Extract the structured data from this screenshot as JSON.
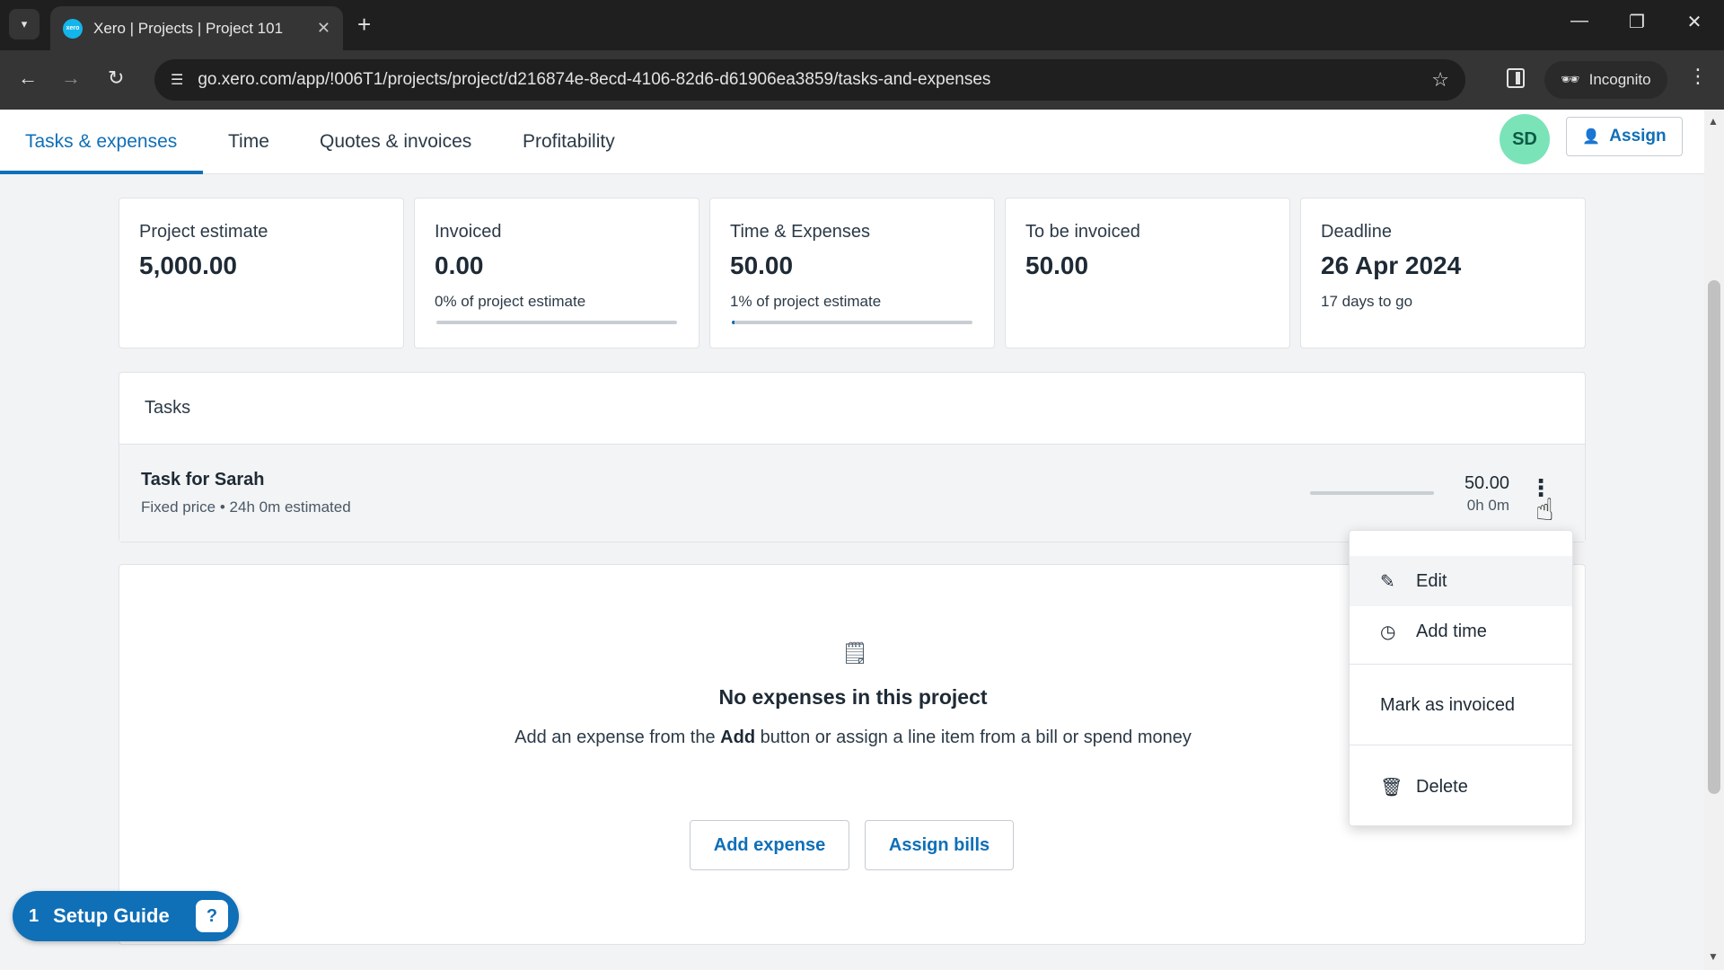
{
  "browser": {
    "tab_title": "Xero | Projects | Project 101",
    "favicon_text": "xero",
    "url": "go.xero.com/app/!006T1/projects/project/d216874e-8ecd-4106-82d6-d61906ea3859/tasks-and-expenses",
    "incognito_label": "Incognito"
  },
  "header": {
    "tabs": [
      {
        "label": "Tasks & expenses",
        "active": true
      },
      {
        "label": "Time",
        "active": false
      },
      {
        "label": "Quotes & invoices",
        "active": false
      },
      {
        "label": "Profitability",
        "active": false
      }
    ],
    "avatar_initials": "SD",
    "assign_label": "Assign"
  },
  "summary": {
    "estimate": {
      "label": "Project estimate",
      "value": "5,000.00"
    },
    "invoiced": {
      "label": "Invoiced",
      "value": "0.00",
      "sub": "0% of project estimate",
      "progress_percent": 0
    },
    "time_expenses": {
      "label": "Time & Expenses",
      "value": "50.00",
      "sub": "1% of project estimate",
      "progress_percent": 1
    },
    "to_be_invoiced": {
      "label": "To be invoiced",
      "value": "50.00"
    },
    "deadline": {
      "label": "Deadline",
      "value": "26 Apr 2024",
      "sub": "17 days to go"
    }
  },
  "tasks": {
    "header": "Tasks",
    "items": [
      {
        "name": "Task for Sarah",
        "meta": "Fixed price • 24h 0m estimated",
        "amount": "50.00",
        "hours": "0h 0m"
      }
    ]
  },
  "task_menu": {
    "edit": "Edit",
    "add_time": "Add time",
    "mark_invoiced": "Mark as invoiced",
    "delete": "Delete"
  },
  "expenses": {
    "empty_title": "No expenses in this project",
    "desc_before": "Add an expense from the ",
    "desc_bold": "Add",
    "desc_after": " button or assign a line item from a bill or spend money",
    "add_expense": "Add expense",
    "assign_bills": "Assign bills"
  },
  "setup_guide": {
    "count": "1",
    "label": "Setup Guide"
  },
  "colors": {
    "accent": "#0f6fb7",
    "avatar_bg": "#7be3b8"
  }
}
